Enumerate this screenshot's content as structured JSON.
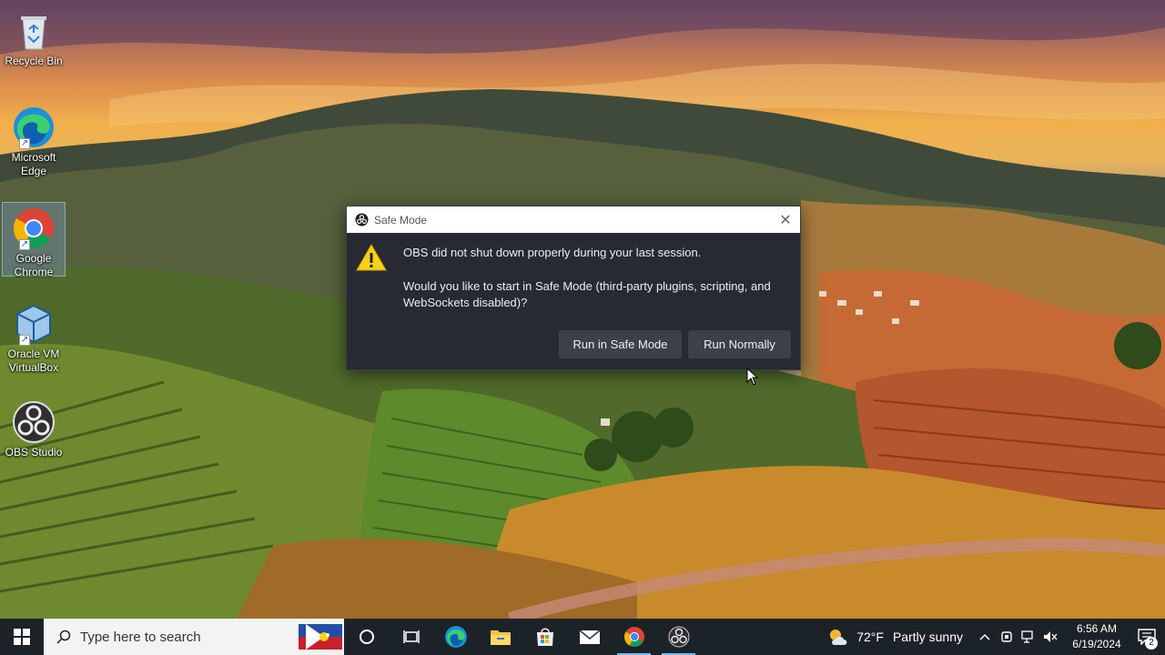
{
  "desktop": {
    "icons": [
      {
        "label": "Recycle Bin"
      },
      {
        "label": "Microsoft Edge"
      },
      {
        "label": "Google Chrome"
      },
      {
        "label": "Oracle VM VirtualBox"
      },
      {
        "label": "OBS Studio"
      }
    ]
  },
  "dialog": {
    "title": "Safe Mode",
    "close_glyph": "✕",
    "message_line1": "OBS did not shut down properly during your last session.",
    "message_line2": "Would you like to start in Safe Mode (third-party plugins, scripting, and WebSockets disabled)?",
    "safe_mode_button": "Run in Safe Mode",
    "run_normally_button": "Run Normally"
  },
  "taskbar": {
    "search_placeholder": "Type here to search",
    "pinned": [
      "cortana-icon",
      "task-view-icon",
      "edge-icon",
      "file-explorer-icon",
      "microsoft-store-icon",
      "mail-icon",
      "chrome-icon",
      "obs-icon"
    ],
    "active_app": "obs-icon"
  },
  "tray": {
    "temperature": "72°F",
    "weather_condition": "Partly sunny",
    "time": "6:56 AM",
    "date": "6/19/2024",
    "notification_count": "2"
  },
  "colors": {
    "dialog_bg": "#272a33",
    "dialog_button": "#3c404b",
    "taskbar_bg": "#1c2328",
    "warning_yellow": "#f7d117"
  }
}
